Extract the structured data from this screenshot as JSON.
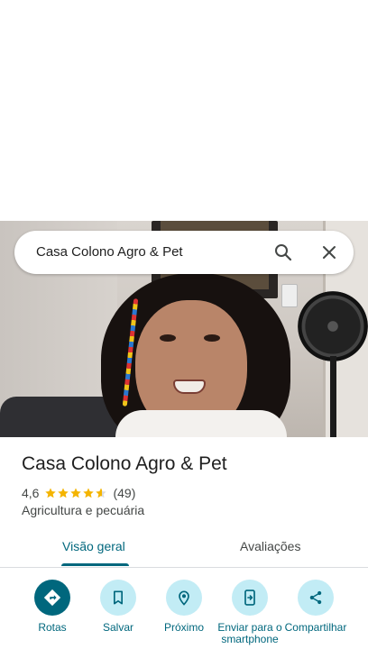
{
  "search": {
    "query": "Casa Colono Agro & Pet"
  },
  "place": {
    "title": "Casa Colono Agro & Pet",
    "rating": "4,6",
    "stars": 4.6,
    "review_count": "(49)",
    "category": "Agricultura e pecuária"
  },
  "tabs": {
    "overview": "Visão geral",
    "reviews": "Avaliações"
  },
  "actions": {
    "directions": "Rotas",
    "save": "Salvar",
    "nearby": "Próximo",
    "send_to_phone": "Enviar para o smartphone",
    "share": "Compartilhar"
  },
  "colors": {
    "accent": "#00677d",
    "action_bg": "#c2ecf5",
    "star": "#f4b400"
  },
  "icons": {
    "search": "search-icon",
    "close": "close-icon",
    "directions": "directions-icon",
    "save": "bookmark-icon",
    "nearby": "nearby-pin-icon",
    "send_to_phone": "phone-send-icon",
    "share": "share-icon"
  }
}
